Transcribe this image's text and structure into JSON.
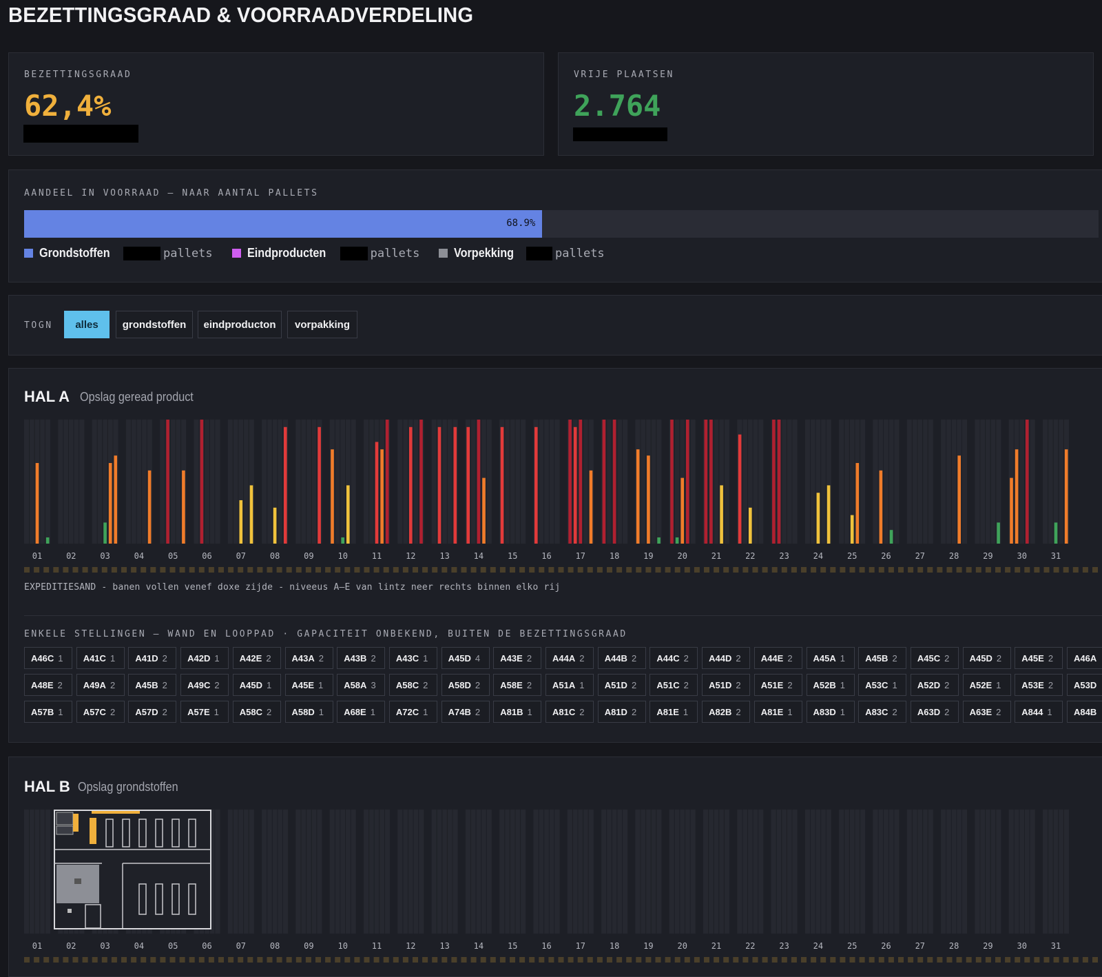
{
  "page": {
    "title": "BEZETTINGSGRAAD & VOORRAADVERDELING"
  },
  "colors": {
    "bg": "#16171c",
    "card": "#1d1f26",
    "occupancy": "#f0b03c",
    "free": "#3fa35a",
    "share": "#6483e3",
    "grondstoffen": "#6483e3",
    "eindproducten": "#cf5ef0",
    "verpakking": "#8d8f96",
    "active": "#5fc0ec",
    "bay_red": "#e23a3a",
    "bay_darkred": "#b02030",
    "bay_orange": "#f07c2a",
    "bay_yellow": "#f0c23c",
    "bay_green": "#3fa35a"
  },
  "kpis": [
    {
      "label": "BEZETTINGSGRAAD",
      "value": "62,4%",
      "color": "#f0b03c"
    },
    {
      "label": "VRIJE PLAATSEN",
      "value": "2.764",
      "color": "#3fa35a"
    }
  ],
  "share": {
    "label": "AANDEEL IN VOORRAAD — NAAR AANTAL PALLETS",
    "percent": 68.9,
    "percent_text": "68.9%",
    "legend": [
      {
        "name": "Grondstoffen",
        "unit": "pallets",
        "color": "#6483e3"
      },
      {
        "name": "Eindproducten",
        "unit": "pallets",
        "color": "#cf5ef0"
      },
      {
        "name": "Vorpekking",
        "unit": "pallets",
        "color": "#8d8f96"
      }
    ]
  },
  "filter": {
    "label": "TOGN",
    "options": [
      {
        "label": "alles",
        "active": true
      },
      {
        "label": "grondstoffen",
        "active": false
      },
      {
        "label": "eindproducton",
        "active": false
      },
      {
        "label": "vorpakking",
        "active": false
      }
    ]
  },
  "rows": [
    "01",
    "02",
    "03",
    "04",
    "05",
    "06",
    "07",
    "08",
    "09",
    "10",
    "11",
    "12",
    "13",
    "14",
    "15",
    "16",
    "17",
    "18",
    "19",
    "20",
    "21",
    "22",
    "23",
    "24",
    "25",
    "26",
    "27",
    "28",
    "29",
    "30",
    "31"
  ],
  "hall_a": {
    "title": "HAL A",
    "subtitle": "Opslag geread product",
    "note": "EXPEDITIESAND - banen vollen venef doxe zijde - niveeus A—E van lintz neer rechts binnen elko rij",
    "bars": [
      {
        "row": 0,
        "lane": 2,
        "fill": 0.65,
        "color": "orange"
      },
      {
        "row": 0,
        "lane": 4,
        "fill": 0.05,
        "color": "green"
      },
      {
        "row": 2,
        "lane": 2,
        "fill": 0.17,
        "color": "green"
      },
      {
        "row": 2,
        "lane": 3,
        "fill": 0.65,
        "color": "orange"
      },
      {
        "row": 2,
        "lane": 4,
        "fill": 0.71,
        "color": "orange"
      },
      {
        "row": 3,
        "lane": 4,
        "fill": 0.59,
        "color": "orange"
      },
      {
        "row": 4,
        "lane": 1,
        "fill": 1.0,
        "color": "darkred"
      },
      {
        "row": 4,
        "lane": 4,
        "fill": 0.59,
        "color": "orange"
      },
      {
        "row": 5,
        "lane": 1,
        "fill": 1.0,
        "color": "darkred"
      },
      {
        "row": 6,
        "lane": 2,
        "fill": 0.35,
        "color": "yellow"
      },
      {
        "row": 6,
        "lane": 4,
        "fill": 0.47,
        "color": "yellow"
      },
      {
        "row": 7,
        "lane": 2,
        "fill": 0.29,
        "color": "yellow"
      },
      {
        "row": 7,
        "lane": 4,
        "fill": 0.94,
        "color": "red"
      },
      {
        "row": 8,
        "lane": 4,
        "fill": 0.94,
        "color": "red"
      },
      {
        "row": 9,
        "lane": 0,
        "fill": 0.76,
        "color": "orange"
      },
      {
        "row": 9,
        "lane": 2,
        "fill": 0.05,
        "color": "green"
      },
      {
        "row": 9,
        "lane": 3,
        "fill": 0.47,
        "color": "yellow"
      },
      {
        "row": 10,
        "lane": 2,
        "fill": 0.82,
        "color": "red"
      },
      {
        "row": 10,
        "lane": 3,
        "fill": 0.76,
        "color": "orange"
      },
      {
        "row": 10,
        "lane": 4,
        "fill": 1.0,
        "color": "darkred"
      },
      {
        "row": 11,
        "lane": 2,
        "fill": 0.94,
        "color": "red"
      },
      {
        "row": 11,
        "lane": 4,
        "fill": 1.0,
        "color": "darkred"
      },
      {
        "row": 12,
        "lane": 1,
        "fill": 0.94,
        "color": "red"
      },
      {
        "row": 12,
        "lane": 4,
        "fill": 0.94,
        "color": "red"
      },
      {
        "row": 13,
        "lane": 0,
        "fill": 0.94,
        "color": "red"
      },
      {
        "row": 13,
        "lane": 2,
        "fill": 1.0,
        "color": "darkred"
      },
      {
        "row": 13,
        "lane": 3,
        "fill": 0.53,
        "color": "orange"
      },
      {
        "row": 14,
        "lane": 0,
        "fill": 0.94,
        "color": "red"
      },
      {
        "row": 15,
        "lane": 0,
        "fill": 0.94,
        "color": "red"
      },
      {
        "row": 16,
        "lane": 0,
        "fill": 1.0,
        "color": "darkred"
      },
      {
        "row": 16,
        "lane": 1,
        "fill": 0.94,
        "color": "red"
      },
      {
        "row": 16,
        "lane": 2,
        "fill": 1.0,
        "color": "darkred"
      },
      {
        "row": 16,
        "lane": 4,
        "fill": 0.59,
        "color": "orange"
      },
      {
        "row": 17,
        "lane": 0,
        "fill": 1.0,
        "color": "darkred"
      },
      {
        "row": 17,
        "lane": 2,
        "fill": 1.0,
        "color": "darkred"
      },
      {
        "row": 18,
        "lane": 0,
        "fill": 0.76,
        "color": "orange"
      },
      {
        "row": 18,
        "lane": 2,
        "fill": 0.71,
        "color": "orange"
      },
      {
        "row": 18,
        "lane": 4,
        "fill": 0.05,
        "color": "green"
      },
      {
        "row": 19,
        "lane": 0,
        "fill": 1.0,
        "color": "darkred"
      },
      {
        "row": 19,
        "lane": 1,
        "fill": 0.05,
        "color": "green"
      },
      {
        "row": 19,
        "lane": 2,
        "fill": 0.53,
        "color": "orange"
      },
      {
        "row": 19,
        "lane": 3,
        "fill": 1.0,
        "color": "darkred"
      },
      {
        "row": 20,
        "lane": 0,
        "fill": 1.0,
        "color": "darkred"
      },
      {
        "row": 20,
        "lane": 1,
        "fill": 1.0,
        "color": "darkred"
      },
      {
        "row": 20,
        "lane": 3,
        "fill": 0.47,
        "color": "yellow"
      },
      {
        "row": 21,
        "lane": 0,
        "fill": 0.88,
        "color": "red"
      },
      {
        "row": 21,
        "lane": 2,
        "fill": 0.29,
        "color": "yellow"
      },
      {
        "row": 22,
        "lane": 0,
        "fill": 1.0,
        "color": "darkred"
      },
      {
        "row": 22,
        "lane": 1,
        "fill": 1.0,
        "color": "darkred"
      },
      {
        "row": 23,
        "lane": 2,
        "fill": 0.41,
        "color": "yellow"
      },
      {
        "row": 23,
        "lane": 4,
        "fill": 0.47,
        "color": "yellow"
      },
      {
        "row": 24,
        "lane": 2,
        "fill": 0.23,
        "color": "yellow"
      },
      {
        "row": 24,
        "lane": 3,
        "fill": 0.65,
        "color": "orange"
      },
      {
        "row": 25,
        "lane": 1,
        "fill": 0.59,
        "color": "orange"
      },
      {
        "row": 25,
        "lane": 3,
        "fill": 0.11,
        "color": "green"
      },
      {
        "row": 27,
        "lane": 3,
        "fill": 0.71,
        "color": "orange"
      },
      {
        "row": 28,
        "lane": 4,
        "fill": 0.17,
        "color": "green"
      },
      {
        "row": 29,
        "lane": 0,
        "fill": 0.53,
        "color": "orange"
      },
      {
        "row": 29,
        "lane": 1,
        "fill": 0.76,
        "color": "orange"
      },
      {
        "row": 29,
        "lane": 3,
        "fill": 1.0,
        "color": "darkred"
      },
      {
        "row": 30,
        "lane": 2,
        "fill": 0.17,
        "color": "green"
      },
      {
        "row": 30,
        "lane": 4,
        "fill": 0.76,
        "color": "orange"
      }
    ]
  },
  "single_racks": {
    "label": "ENKELE STELLINGEN — WAND EN LOOPPAD · GAPACITEIT ONBEKEND, BUITEN DE BEZETTINGSGRAAD",
    "rows": [
      [
        {
          "n": "A46C",
          "c": "1"
        },
        {
          "n": "A41C",
          "c": "1"
        },
        {
          "n": "A41D",
          "c": "2"
        },
        {
          "n": "A42D",
          "c": "1"
        },
        {
          "n": "A42E",
          "c": "2"
        },
        {
          "n": "A43A",
          "c": "2"
        },
        {
          "n": "A43B",
          "c": "2"
        },
        {
          "n": "A43C",
          "c": "1"
        },
        {
          "n": "A45D",
          "c": "4"
        },
        {
          "n": "A43E",
          "c": "2"
        },
        {
          "n": "A44A",
          "c": "2"
        },
        {
          "n": "A44B",
          "c": "2"
        },
        {
          "n": "A44C",
          "c": "2"
        },
        {
          "n": "A44D",
          "c": "2"
        },
        {
          "n": "A44E",
          "c": "2"
        },
        {
          "n": "A45A",
          "c": "1"
        },
        {
          "n": "A45B",
          "c": "2"
        },
        {
          "n": "A45C",
          "c": "2"
        },
        {
          "n": "A45D",
          "c": "2"
        },
        {
          "n": "A45E",
          "c": "2"
        },
        {
          "n": "A46A",
          "c": ""
        }
      ],
      [
        {
          "n": "A48E",
          "c": "2"
        },
        {
          "n": "A49A",
          "c": "2"
        },
        {
          "n": "A45B",
          "c": "2"
        },
        {
          "n": "A49C",
          "c": "2"
        },
        {
          "n": "A45D",
          "c": "1"
        },
        {
          "n": "A45E",
          "c": "1"
        },
        {
          "n": "A58A",
          "c": "3"
        },
        {
          "n": "A58C",
          "c": "2"
        },
        {
          "n": "A58D",
          "c": "2"
        },
        {
          "n": "A58E",
          "c": "2"
        },
        {
          "n": "A51A",
          "c": "1"
        },
        {
          "n": "A51D",
          "c": "2"
        },
        {
          "n": "A51C",
          "c": "2"
        },
        {
          "n": "A51D",
          "c": "2"
        },
        {
          "n": "A51E",
          "c": "2"
        },
        {
          "n": "A52B",
          "c": "1"
        },
        {
          "n": "A53C",
          "c": "1"
        },
        {
          "n": "A52D",
          "c": "2"
        },
        {
          "n": "A52E",
          "c": "1"
        },
        {
          "n": "A53E",
          "c": "2"
        },
        {
          "n": "A53D",
          "c": ""
        }
      ],
      [
        {
          "n": "A57B",
          "c": "1"
        },
        {
          "n": "A57C",
          "c": "2"
        },
        {
          "n": "A57D",
          "c": "2"
        },
        {
          "n": "A57E",
          "c": "1"
        },
        {
          "n": "A58C",
          "c": "2"
        },
        {
          "n": "A58D",
          "c": "1"
        },
        {
          "n": "A68E",
          "c": "1"
        },
        {
          "n": "A72C",
          "c": "1"
        },
        {
          "n": "A74B",
          "c": "2"
        },
        {
          "n": "A81B",
          "c": "1"
        },
        {
          "n": "A81C",
          "c": "2"
        },
        {
          "n": "A81D",
          "c": "2"
        },
        {
          "n": "A81E",
          "c": "1"
        },
        {
          "n": "A82B",
          "c": "2"
        },
        {
          "n": "A81E",
          "c": "1"
        },
        {
          "n": "A83D",
          "c": "1"
        },
        {
          "n": "A83C",
          "c": "2"
        },
        {
          "n": "A63D",
          "c": "2"
        },
        {
          "n": "A63E",
          "c": "2"
        },
        {
          "n": "A844",
          "c": "1"
        },
        {
          "n": "A84B",
          "c": ""
        }
      ]
    ]
  },
  "hall_b": {
    "title": "HAL B",
    "subtitle": "Opslag grondstoffen"
  }
}
